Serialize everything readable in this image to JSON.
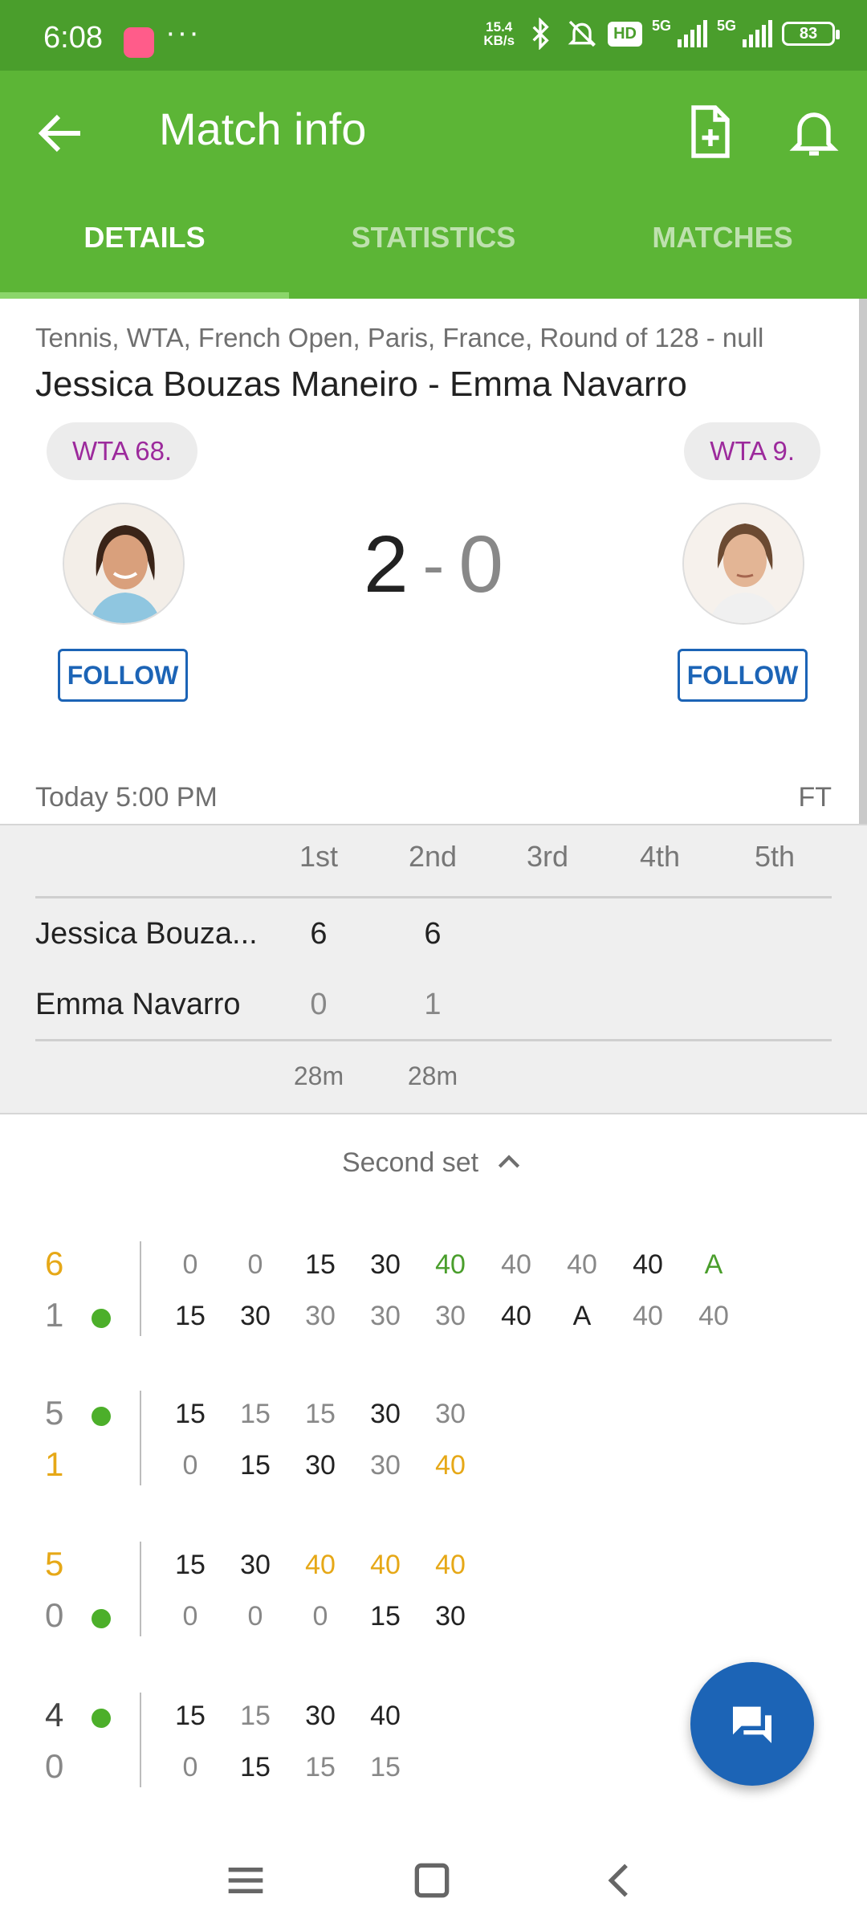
{
  "status_bar": {
    "time": "6:08",
    "overflow": "···",
    "net_speed_top": "15.4",
    "net_speed_bottom": "KB/s",
    "hd": "HD",
    "network_1": "5G",
    "network_2": "5G",
    "battery": "83"
  },
  "app_bar": {
    "title": "Match info",
    "back_icon": "arrow-back-icon",
    "doc_icon": "add-document-icon",
    "bell_icon": "bell-icon"
  },
  "tabs": [
    {
      "label": "DETAILS",
      "active": true
    },
    {
      "label": "STATISTICS",
      "active": false
    },
    {
      "label": "MATCHES",
      "active": false
    }
  ],
  "match": {
    "breadcrumb": "Tennis, WTA, French Open, Paris, France, Round of 128 - null",
    "title": "Jessica Bouzas Maneiro - Emma Navarro",
    "home_rank": "WTA 68.",
    "away_rank": "WTA 9.",
    "home_follow": "FOLLOW",
    "away_follow": "FOLLOW",
    "home_sets": "2",
    "separator": "-",
    "away_sets": "0",
    "date": "Today 5:00 PM",
    "status": "FT"
  },
  "score_table": {
    "headers": [
      "1st",
      "2nd",
      "3rd",
      "4th",
      "5th"
    ],
    "rows": [
      {
        "name": "Jessica Bouza...",
        "scores": [
          "6",
          "6"
        ]
      },
      {
        "name": "Emma Navarro",
        "scores": [
          "0",
          "1"
        ]
      }
    ],
    "durations": [
      "28m",
      "28m"
    ]
  },
  "set_toggle": {
    "label": "Second set",
    "icon": "chevron-up-icon"
  },
  "games": [
    {
      "top": {
        "score": "6",
        "score_color": "#e6a817",
        "serve": false,
        "points": [
          "0",
          "0",
          "15",
          "30",
          "40",
          "40",
          "40",
          "40",
          "A"
        ],
        "colors": [
          "#888",
          "#888",
          "#222",
          "#222",
          "#4a9e2c",
          "#888",
          "#888",
          "#222",
          "#4a9e2c"
        ]
      },
      "bottom": {
        "score": "1",
        "score_color": "#888",
        "serve": true,
        "points": [
          "15",
          "30",
          "30",
          "30",
          "30",
          "40",
          "A",
          "40",
          "40"
        ],
        "colors": [
          "#222",
          "#222",
          "#888",
          "#888",
          "#888",
          "#222",
          "#222",
          "#888",
          "#888"
        ]
      }
    },
    {
      "top": {
        "score": "5",
        "score_color": "#888",
        "serve": true,
        "points": [
          "15",
          "15",
          "15",
          "30",
          "30"
        ],
        "colors": [
          "#222",
          "#888",
          "#888",
          "#222",
          "#888"
        ]
      },
      "bottom": {
        "score": "1",
        "score_color": "#e6a817",
        "serve": false,
        "points": [
          "0",
          "15",
          "30",
          "30",
          "40"
        ],
        "colors": [
          "#888",
          "#222",
          "#222",
          "#888",
          "#e6a817"
        ]
      }
    },
    {
      "top": {
        "score": "5",
        "score_color": "#e6a817",
        "serve": false,
        "points": [
          "15",
          "30",
          "40",
          "40",
          "40"
        ],
        "colors": [
          "#222",
          "#222",
          "#e6a817",
          "#e6a817",
          "#e6a817"
        ]
      },
      "bottom": {
        "score": "0",
        "score_color": "#888",
        "serve": true,
        "points": [
          "0",
          "0",
          "0",
          "15",
          "30"
        ],
        "colors": [
          "#888",
          "#888",
          "#888",
          "#222",
          "#222"
        ]
      }
    },
    {
      "top": {
        "score": "4",
        "score_color": "#444",
        "serve": true,
        "points": [
          "15",
          "15",
          "30",
          "40"
        ],
        "colors": [
          "#222",
          "#888",
          "#222",
          "#222"
        ]
      },
      "bottom": {
        "score": "0",
        "score_color": "#888",
        "serve": false,
        "points": [
          "0",
          "15",
          "15",
          "15"
        ],
        "colors": [
          "#888",
          "#222",
          "#888",
          "#888"
        ]
      }
    }
  ],
  "fab_icon": "chat-icon",
  "nav": {
    "menu_icon": "menu-icon",
    "home_icon": "home-square-icon",
    "back_icon": "back-chevron-icon"
  },
  "colors": {
    "primary_green": "#5cb536",
    "status_green": "#4a9e2c",
    "accent_blue": "#1c64b6",
    "rank_purple": "#9c2a9c",
    "winner_yellow": "#e6a817"
  }
}
